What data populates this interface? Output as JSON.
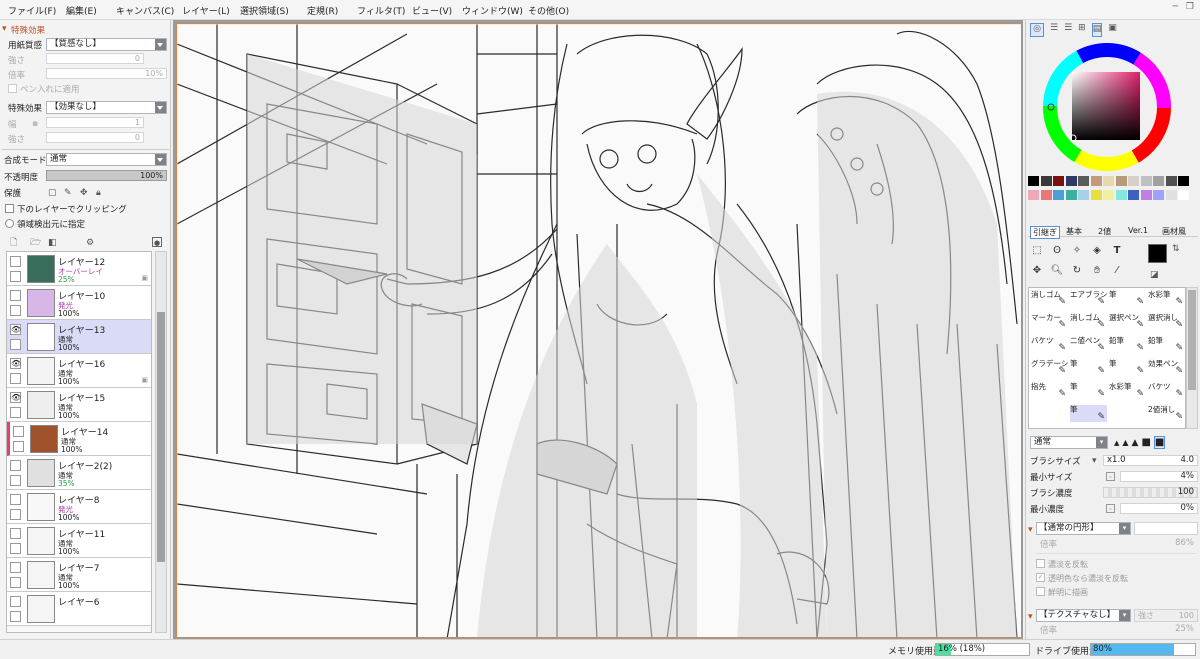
{
  "menu": [
    {
      "label": "ファイル(F)"
    },
    {
      "label": "編集(E)"
    },
    {
      "label": "キャンバス(C)"
    },
    {
      "label": "レイヤー(L)"
    },
    {
      "label": "選択領域(S)"
    },
    {
      "label": "定規(R)"
    },
    {
      "label": "フィルタ(T)"
    },
    {
      "label": "ビュー(V)"
    },
    {
      "label": "ウィンドウ(W)"
    },
    {
      "label": "その他(O)"
    }
  ],
  "left_panel": {
    "section_title": "特殊効果",
    "paper_label": "用紙質感",
    "paper_value": "【質感なし】",
    "strength_label": "強さ",
    "strength_value": "0",
    "scale_label": "倍率",
    "scale_value": "10%",
    "pen_apply_label": "ペン入れに適用",
    "effect_label": "特殊効果",
    "effect_value": "【効果なし】",
    "width_label": "幅",
    "width_value": "1",
    "strength2_label": "強さ",
    "strength2_value": "0",
    "blend_label": "合成モード",
    "blend_value": "通常",
    "opacity_label": "不透明度",
    "opacity_value": "100%",
    "protect_label": "保護",
    "clip_label": "下のレイヤーでクリッピング",
    "detect_label": "領域検出元に指定"
  },
  "layers": [
    {
      "name": "レイヤー12",
      "mode": "オーバーレイ",
      "opacity": "25%",
      "mode_color": "purple",
      "op_color": "green",
      "visible": false,
      "selected": false,
      "thumb": "#3a6e5c",
      "clip": true
    },
    {
      "name": "レイヤー10",
      "mode": "発光",
      "opacity": "100%",
      "mode_color": "purple",
      "op_color": "",
      "visible": false,
      "selected": false,
      "thumb": "#d9b6e8",
      "clip": false
    },
    {
      "name": "レイヤー13",
      "mode": "通常",
      "opacity": "100%",
      "mode_color": "",
      "op_color": "",
      "visible": true,
      "selected": true,
      "thumb": "#ffffff",
      "clip": false
    },
    {
      "name": "レイヤー16",
      "mode": "通常",
      "opacity": "100%",
      "mode_color": "",
      "op_color": "",
      "visible": true,
      "selected": false,
      "thumb": "#f4f4f4",
      "clip": true
    },
    {
      "name": "レイヤー15",
      "mode": "通常",
      "opacity": "100%",
      "mode_color": "",
      "op_color": "",
      "visible": true,
      "selected": false,
      "thumb": "#eeeeee",
      "clip": false
    },
    {
      "name": "レイヤー14",
      "mode": "通常",
      "opacity": "100%",
      "mode_color": "",
      "op_color": "",
      "visible": false,
      "selected": false,
      "thumb": "#a0522d",
      "clip": false
    },
    {
      "name": "レイヤー2(2)",
      "mode": "通常",
      "opacity": "35%",
      "mode_color": "",
      "op_color": "green",
      "visible": false,
      "selected": false,
      "thumb": "#e0e0e0",
      "clip": false
    },
    {
      "name": "レイヤー8",
      "mode": "発光",
      "opacity": "100%",
      "mode_color": "purple",
      "op_color": "",
      "visible": false,
      "selected": false,
      "thumb": "#f8f8f8",
      "clip": false
    },
    {
      "name": "レイヤー11",
      "mode": "通常",
      "opacity": "100%",
      "mode_color": "",
      "op_color": "",
      "visible": false,
      "selected": false,
      "thumb": "#f5f5f5",
      "clip": false
    },
    {
      "name": "レイヤー7",
      "mode": "通常",
      "opacity": "100%",
      "mode_color": "",
      "op_color": "",
      "visible": false,
      "selected": false,
      "thumb": "#f5f5f5",
      "clip": false
    },
    {
      "name": "レイヤー6",
      "mode": "",
      "opacity": "",
      "mode_color": "",
      "op_color": "",
      "visible": false,
      "selected": false,
      "thumb": "#f5f5f5",
      "clip": false
    }
  ],
  "right_panel": {
    "brush_tabs": [
      "引継ぎ",
      "基本",
      "2値",
      "Ver.1",
      "画材風"
    ],
    "brushes": [
      [
        "消しゴム",
        "エアブラシ",
        "筆",
        "水彩筆"
      ],
      [
        "マーカー",
        "消しゴム",
        "選択ペン",
        "選択消し"
      ],
      [
        "バケツ",
        "二値ペン",
        "鉛筆",
        "鉛筆"
      ],
      [
        "グラデーション",
        "筆",
        "筆",
        "効果ペン"
      ],
      [
        "指先",
        "筆",
        "水彩筆",
        "バケツ"
      ],
      [
        "",
        "筆",
        "",
        "2値消し"
      ]
    ],
    "blend_value": "通常",
    "size_label": "ブラシサイズ",
    "size_mult": "x1.0",
    "size_value": "4.0",
    "min_size_label": "最小サイズ",
    "min_size_value": "4%",
    "density_label": "ブラシ濃度",
    "density_value": "100",
    "min_density_label": "最小濃度",
    "min_density_value": "0%",
    "shape_value": "【通常の円形】",
    "shape_scale_label": "倍率",
    "shape_scale_value": "86%",
    "opt1": "濃淡を反転",
    "opt2": "透明色なら濃淡を反転",
    "opt3": "鮮明に描画",
    "texture_value": "【テクスチャなし】",
    "texture_strength_label": "強さ",
    "texture_strength_value": "100",
    "texture_scale_label": "倍率",
    "texture_scale_value": "25%"
  },
  "status": {
    "memory_label": "メモリ使用量",
    "memory_value": "16% (18%)",
    "memory_fill": 0.16,
    "drive_label": "ドライブ使用量",
    "drive_value": "80%",
    "drive_fill": 0.8
  },
  "swatches": [
    "#000000",
    "#3a3a3a",
    "#7a1010",
    "#2c3a64",
    "#5a5a5a",
    "#c39a7a",
    "#e8d8b0",
    "#b59b78",
    "#d8d0c8",
    "#c0c0c0",
    "#a0a0a0",
    "#505050",
    "#000000",
    "#f0a8b8",
    "#e87878",
    "#48a0d8",
    "#3cb0a0",
    "#a8d0e8",
    "#e8e040",
    "#f0f0a0",
    "#80e8e0",
    "#4060c0",
    "#c080e0",
    "#a0a0ff",
    "#e0e0e0",
    "#ffffff"
  ],
  "colors": {
    "accent": "#2d9c40",
    "selected_layer": "#dadbf7",
    "overlay": "#b03aa8"
  }
}
